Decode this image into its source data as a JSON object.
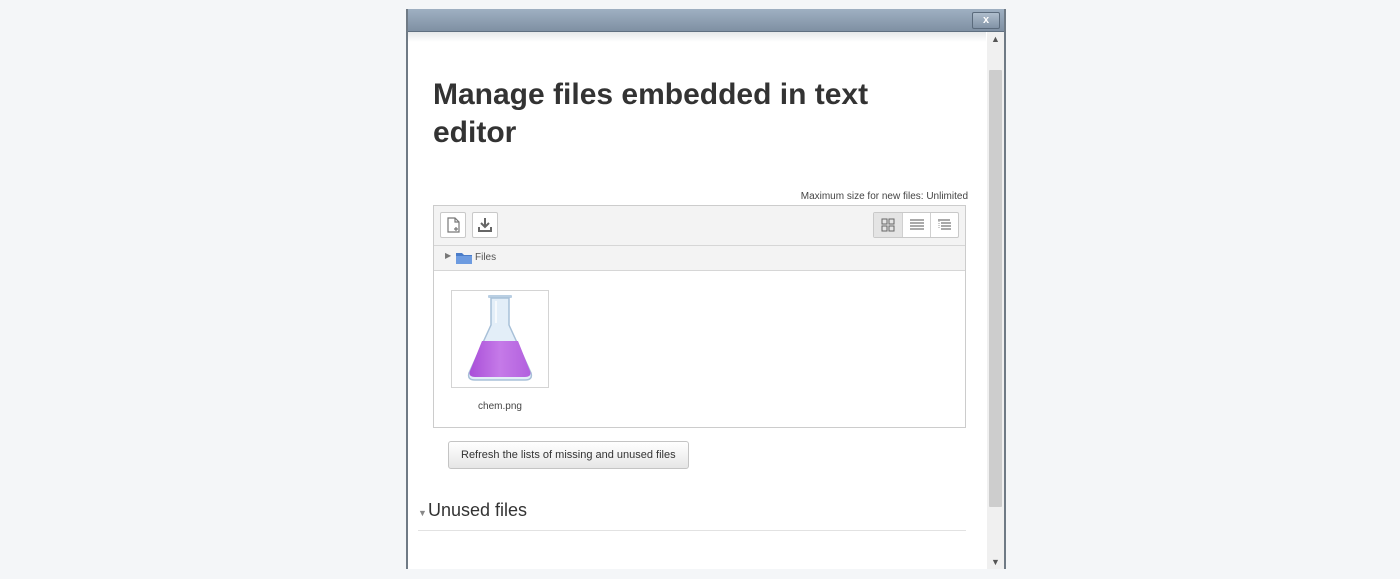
{
  "dialog": {
    "close_label": "x"
  },
  "page": {
    "title": "Manage files embedded in text editor"
  },
  "filemanager": {
    "max_size_text": "Maximum size for new files: Unlimited",
    "toolbar": {
      "add_icon": "add-file-icon",
      "download_icon": "download-icon",
      "views": [
        "icons-view-icon",
        "list-view-icon",
        "tree-view-icon"
      ],
      "active_view": "icons-view-icon"
    },
    "path": {
      "label": "Files",
      "icon": "folder-icon"
    },
    "files": [
      {
        "name": "chem.png",
        "icon": "flask-thumbnail"
      }
    ]
  },
  "actions": {
    "refresh_label": "Refresh the lists of missing and unused files"
  },
  "unused": {
    "title": "Unused files",
    "expanded": true
  },
  "colors": {
    "titlebar": "#8fa0b2",
    "folder": "#4a7cc9",
    "flask_liquid": "#c06fe6"
  }
}
